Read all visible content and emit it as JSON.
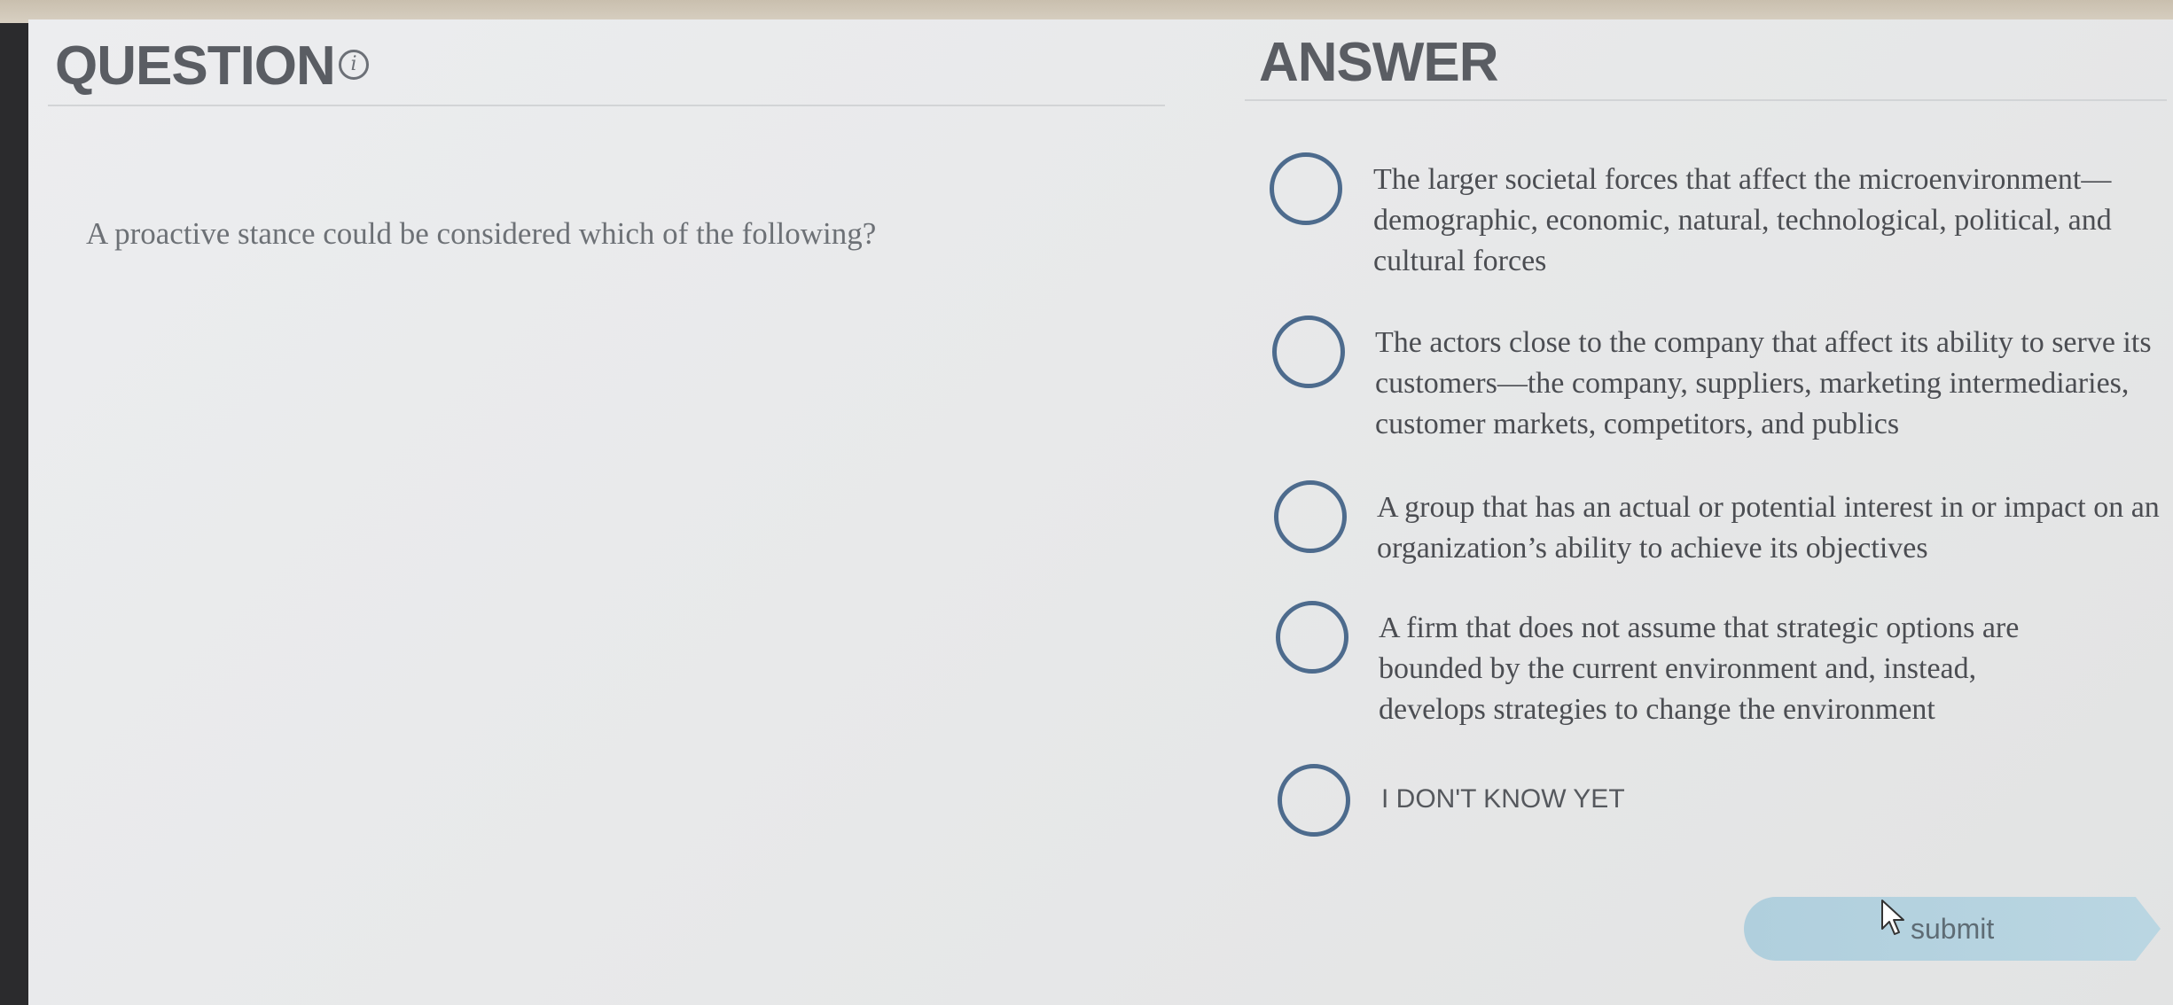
{
  "question": {
    "heading": "QUESTION",
    "text": "A proactive stance could be considered which of the following?"
  },
  "answer": {
    "heading": "ANSWER",
    "options": [
      {
        "label": "The larger societal forces that affect the microenvironment—demographic, economic, natural, technological, political, and cultural forces"
      },
      {
        "label": "The actors close to the company that affect its ability to serve its customers—the company, suppliers, marketing intermediaries, customer markets, competitors, and publics"
      },
      {
        "label": "A group that has an actual or potential interest in or impact on an organization’s ability to achieve its objectives"
      },
      {
        "label": "A firm that does not assume that strategic options are bounded by the current environment and, instead, develops strategies to change the environment"
      },
      {
        "label": "I DON'T KNOW YET"
      }
    ]
  },
  "submit_label": "submit",
  "icons": {
    "info": "info-icon",
    "radio": "radio-circle",
    "cursor": "mouse-pointer-icon"
  },
  "colors": {
    "radio_border": "#4d6b8d",
    "submit_bg": "#b0cfdd",
    "heading": "#5a5d63"
  }
}
